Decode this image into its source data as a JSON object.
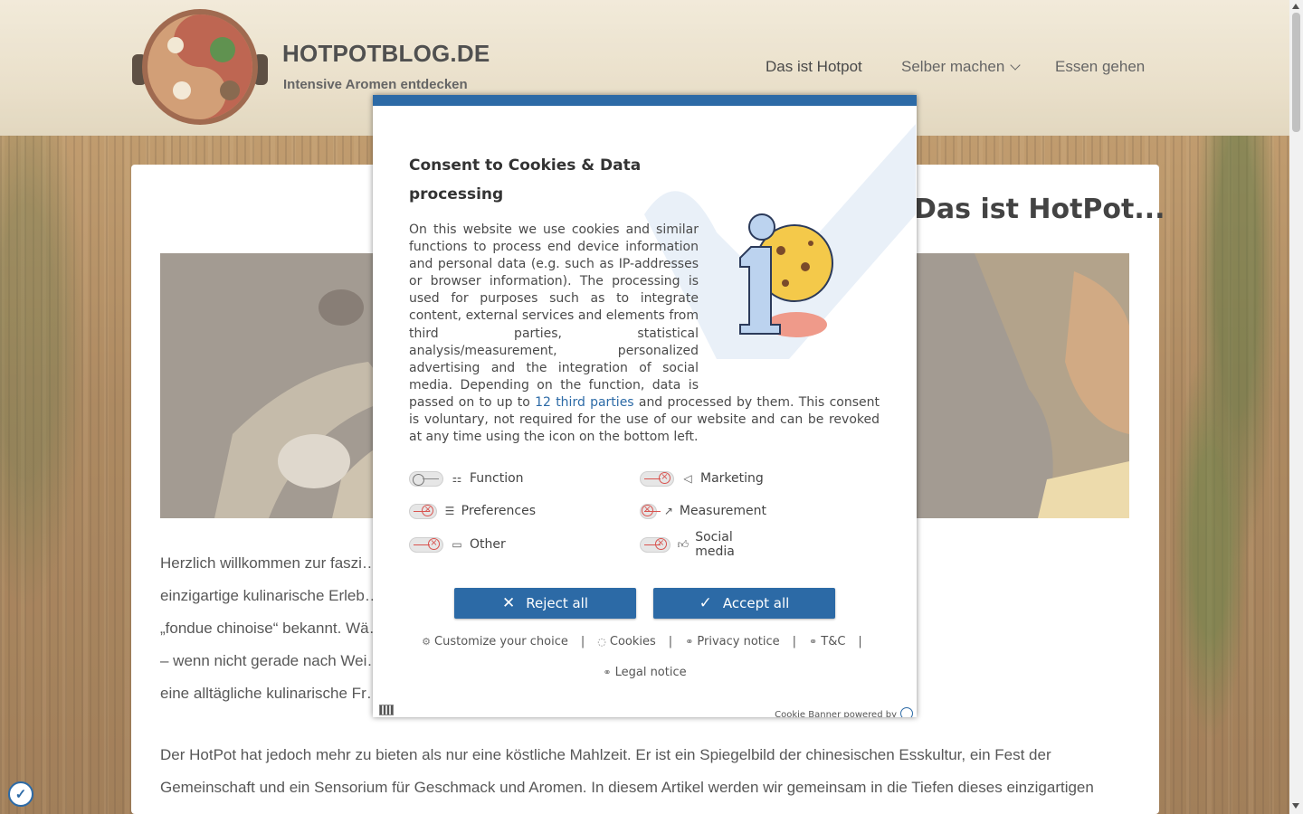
{
  "header": {
    "site_title": "HOTPOTBLOG.DE",
    "tagline": "Intensive Aromen entdecken",
    "logo_icon": "hotpot-logo"
  },
  "nav": {
    "items": [
      {
        "label": "Das ist Hotpot",
        "active": true
      },
      {
        "label": "Selber machen",
        "has_dropdown": true
      },
      {
        "label": "Essen gehen"
      }
    ]
  },
  "article": {
    "title": "Das ist HotPot...",
    "paragraph_1": [
      "Herzlich willkommen zur faszi… tschland bekannt. Dieses",
      "einzigartige kulinarische Erleb… t in der Schweiz auch als",
      "„fondue chinoise“ bekannt. Wä… n in Verbindung gebracht wird",
      "– wenn nicht gerade nach Wei… hundertealte Tradition und",
      "eine alltägliche kulinarische Fr…"
    ],
    "paragraph_2": [
      "Der HotPot hat jedoch mehr zu bieten als nur eine köstliche Mahlzeit. Er ist ein Spiegelbild der chinesischen Esskultur, ein Fest der",
      "Gemeinschaft und ein Sensorium für Geschmack und Aromen. In diesem Artikel werden wir gemeinsam in die Tiefen dieses einzigartigen"
    ]
  },
  "cookie_banner": {
    "title": "Consent to Cookies & Data processing",
    "text_before_link": "On this website we use cookies and similar functions to process end device information and personal data (e.g. such as IP-addresses or browser information). The processing is used for purposes such as to integrate content, external services and elements from third parties, statistical analysis/measurement, personalized advertising and the integration of social media. Depending on the function, data is passed on to up to ",
    "link_text": "12 third parties",
    "text_after_link": " and processed by them. This consent is voluntary, not required for the use of our website and can be revoked at any time using the icon on the bottom left.",
    "toggles": [
      {
        "label": "Function",
        "icon": "function-icon",
        "enabled": true
      },
      {
        "label": "Marketing",
        "icon": "megaphone-icon",
        "enabled": false
      },
      {
        "label": "Preferences",
        "icon": "sliders-icon",
        "enabled": false
      },
      {
        "label": "Measurement",
        "icon": "chart-icon",
        "enabled": false
      },
      {
        "label": "Other",
        "icon": "chat-icon",
        "enabled": false
      },
      {
        "label": "Social media",
        "icon": "thumbs-up-icon",
        "enabled": false
      }
    ],
    "reject_label": "Reject all",
    "accept_label": "Accept all",
    "links": {
      "customize": "Customize your choice",
      "cookies": "Cookies",
      "privacy": "Privacy notice",
      "tc": "T&C",
      "legal": "Legal notice"
    },
    "powered_by": "Cookie Banner powered by",
    "accent_color": "#2c6aa6"
  }
}
